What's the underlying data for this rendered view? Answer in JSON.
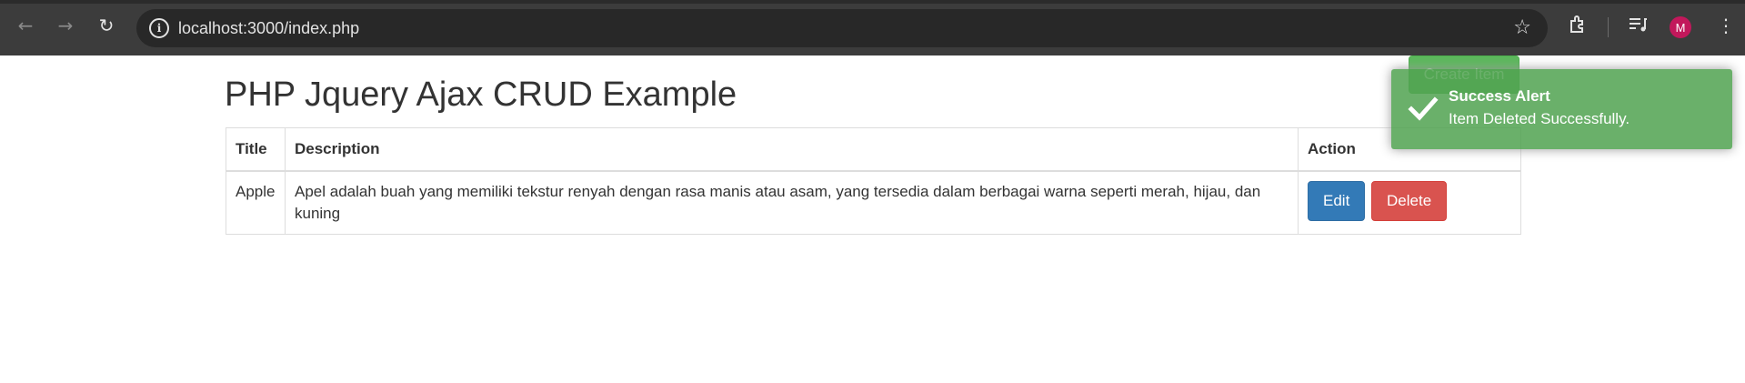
{
  "browser": {
    "url": "localhost:3000/index.php",
    "back_icon": "back-arrow-icon",
    "forward_icon": "forward-arrow-icon",
    "reload_icon": "reload-icon",
    "avatar_letter": "M"
  },
  "page": {
    "title": "PHP Jquery Ajax CRUD Example",
    "create_button_label": "Create Item",
    "table": {
      "headers": [
        "Title",
        "Description",
        "Action"
      ],
      "rows": [
        {
          "title": "Apple",
          "description": "Apel adalah buah yang memiliki tekstur renyah dengan rasa manis atau asam, yang tersedia dalam berbagai warna seperti merah, hijau, dan kuning",
          "edit_label": "Edit",
          "delete_label": "Delete"
        }
      ]
    }
  },
  "toast": {
    "title": "Success Alert",
    "message": "Item Deleted Successfully.",
    "icon": "check-icon",
    "color": "#51a351"
  },
  "colors": {
    "edit": "#337ab7",
    "delete": "#d9534f",
    "create": "#5cb85c"
  }
}
